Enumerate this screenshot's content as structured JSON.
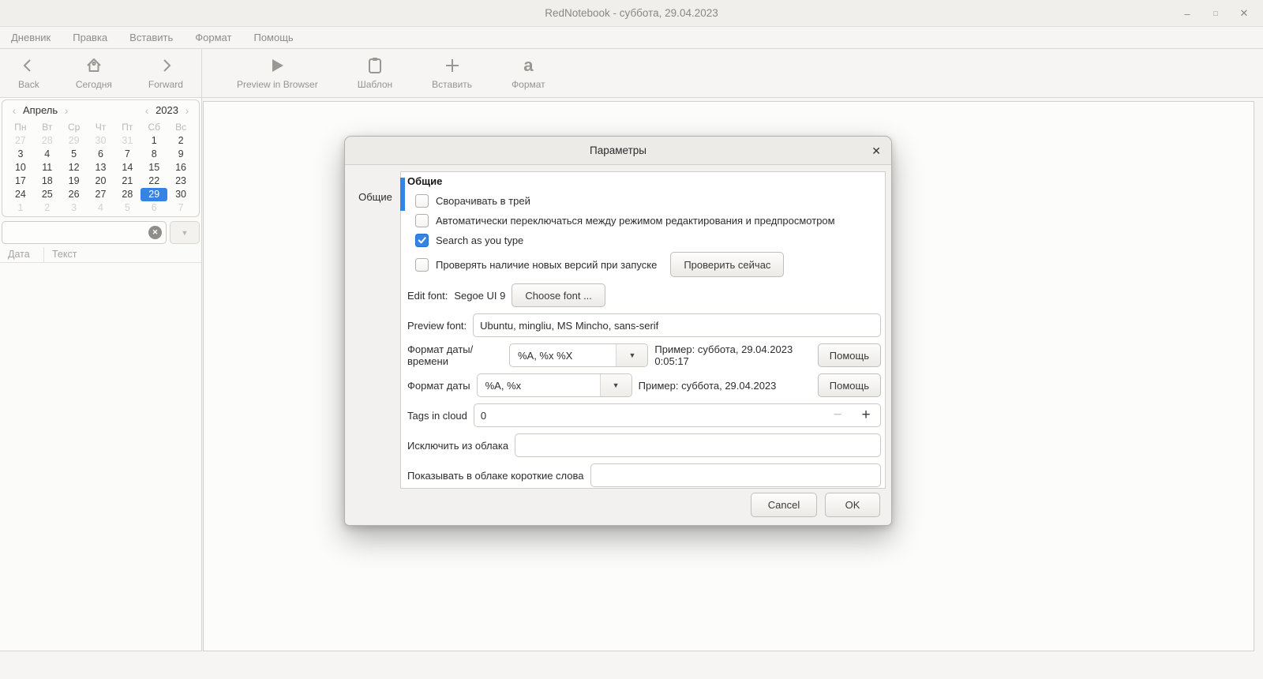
{
  "window": {
    "title": "RedNotebook - суббота, 29.04.2023"
  },
  "icons": {
    "minimize": "–",
    "maximize": "□",
    "close": "✕",
    "dialog_close": "✕",
    "dropdown": "▼",
    "clear": "✕",
    "minus": "−",
    "plus": "+",
    "prev": "‹",
    "next": "›",
    "format_glyph": "a"
  },
  "colors": {
    "accent": "#3584e4",
    "selected_day_bg": "#3584e4"
  },
  "menu": {
    "items": [
      "Дневник",
      "Правка",
      "Вставить",
      "Формат",
      "Помощь"
    ]
  },
  "toolbar": {
    "items": [
      {
        "label": "Back"
      },
      {
        "label": "Сегодня"
      },
      {
        "label": "Forward"
      },
      {
        "label": "Preview in Browser"
      },
      {
        "label": "Шаблон"
      },
      {
        "label": "Вставить"
      },
      {
        "label": "Формат"
      }
    ]
  },
  "calendar": {
    "month": "Апрель",
    "year": "2023",
    "weekdays": [
      "Пн",
      "Вт",
      "Ср",
      "Чт",
      "Пт",
      "Сб",
      "Вс"
    ],
    "days": [
      {
        "d": "27",
        "muted": true
      },
      {
        "d": "28",
        "muted": true
      },
      {
        "d": "29",
        "muted": true
      },
      {
        "d": "30",
        "muted": true
      },
      {
        "d": "31",
        "muted": true
      },
      {
        "d": "1"
      },
      {
        "d": "2"
      },
      {
        "d": "3"
      },
      {
        "d": "4"
      },
      {
        "d": "5"
      },
      {
        "d": "6"
      },
      {
        "d": "7"
      },
      {
        "d": "8"
      },
      {
        "d": "9"
      },
      {
        "d": "10"
      },
      {
        "d": "11"
      },
      {
        "d": "12"
      },
      {
        "d": "13"
      },
      {
        "d": "14"
      },
      {
        "d": "15"
      },
      {
        "d": "16"
      },
      {
        "d": "17"
      },
      {
        "d": "18"
      },
      {
        "d": "19"
      },
      {
        "d": "20"
      },
      {
        "d": "21"
      },
      {
        "d": "22"
      },
      {
        "d": "23"
      },
      {
        "d": "24"
      },
      {
        "d": "25"
      },
      {
        "d": "26"
      },
      {
        "d": "27"
      },
      {
        "d": "28"
      },
      {
        "d": "29",
        "selected": true
      },
      {
        "d": "30"
      },
      {
        "d": "1",
        "muted": true
      },
      {
        "d": "2",
        "muted": true
      },
      {
        "d": "3",
        "muted": true
      },
      {
        "d": "4",
        "muted": true
      },
      {
        "d": "5",
        "muted": true
      },
      {
        "d": "6",
        "muted": true
      },
      {
        "d": "7",
        "muted": true
      }
    ],
    "selected_day": "29"
  },
  "search": {
    "value": ""
  },
  "results": {
    "columns": [
      "Дата",
      "Текст"
    ]
  },
  "dialog": {
    "title": "Параметры",
    "tab": "Общие",
    "section_header": "Общие",
    "checkboxes": [
      {
        "label": "Сворачивать в трей",
        "checked": false
      },
      {
        "label": "Автоматически переключаться между режимом редактирования и предпросмотром",
        "checked": false
      },
      {
        "label": "Search as you type",
        "checked": true
      },
      {
        "label": "Проверять наличие новых версий при запуске",
        "checked": false
      }
    ],
    "check_now_button": "Проверить сейчас",
    "edit_font": {
      "label": "Edit font:",
      "value": "Segoe UI 9",
      "button": "Choose font ..."
    },
    "preview_font": {
      "label": "Preview font:",
      "value": "Ubuntu, mingliu, MS Mincho, sans-serif"
    },
    "datetime_format": {
      "label": "Формат даты/времени",
      "value": "%A, %x %X",
      "example": "Пример: суббота, 29.04.2023 0:05:17",
      "help": "Помощь"
    },
    "date_format": {
      "label": "Формат даты",
      "value": "%A, %x",
      "example": "Пример: суббота, 29.04.2023",
      "help": "Помощь"
    },
    "tags_in_cloud": {
      "label": "Tags in cloud",
      "value": "0"
    },
    "exclude_from_cloud": {
      "label": "Исключить из облака",
      "value": ""
    },
    "short_words": {
      "label": "Показывать в облаке короткие слова",
      "value": ""
    },
    "buttons": {
      "cancel": "Cancel",
      "ok": "OK"
    }
  }
}
